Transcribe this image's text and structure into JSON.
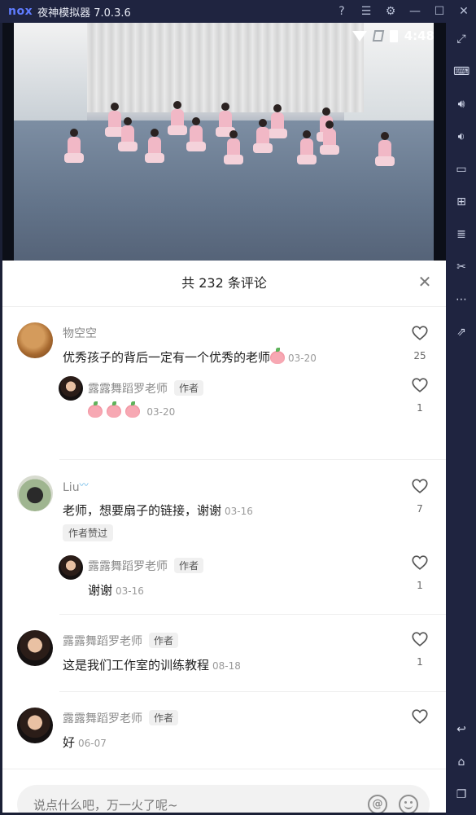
{
  "emulator": {
    "brand": "nox",
    "title": "夜神模拟器 7.0.3.6",
    "controls": [
      "help-icon",
      "menu-icon",
      "settings-icon",
      "minimize-icon",
      "maximize-icon",
      "close-icon"
    ]
  },
  "toolbar": {
    "icons": [
      "fullscreen-icon",
      "keyboard-icon",
      "volume-up-icon",
      "volume-down-icon",
      "screen-icon",
      "apk-install-icon",
      "multi-instance-icon",
      "scissors-icon",
      "more-icon",
      "share-icon",
      "back-icon",
      "home-icon",
      "recent-apps-icon"
    ]
  },
  "statusbar": {
    "time": "4:48"
  },
  "comments_sheet": {
    "title": "共 232 条评论",
    "comments": [
      {
        "username": "物空空",
        "text": "优秀孩子的背后一定有一个优秀的老师",
        "date": "03-20",
        "likes": "25",
        "reply": {
          "username": "露露舞蹈罗老师",
          "author_tag": "作者",
          "date": "03-20",
          "likes": "1"
        }
      },
      {
        "username": "Liu",
        "text": "老师，想要扇子的链接，谢谢",
        "date": "03-16",
        "likes": "7",
        "liked_by_author": "作者赞过",
        "reply": {
          "username": "露露舞蹈罗老师",
          "author_tag": "作者",
          "text": "谢谢",
          "date": "03-16",
          "likes": "1"
        }
      },
      {
        "username": "露露舞蹈罗老师",
        "author_tag": "作者",
        "text": "这是我们工作室的训练教程",
        "date": "08-18",
        "likes": "1"
      },
      {
        "username": "露露舞蹈罗老师",
        "author_tag": "作者",
        "text": "好",
        "date": "06-07",
        "likes": ""
      }
    ],
    "input_placeholder": "说点什么吧，万一火了呢~"
  }
}
